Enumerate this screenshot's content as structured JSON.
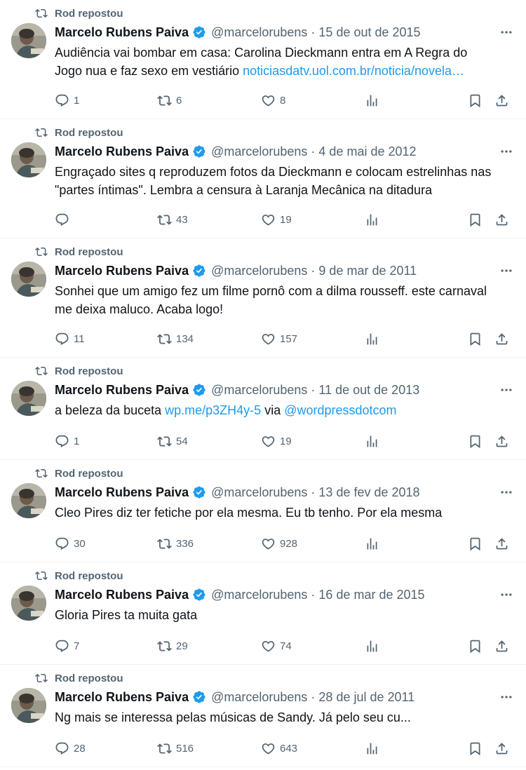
{
  "tweets": [
    {
      "repost_label": "Rod repostou",
      "name": "Marcelo Rubens Paiva",
      "handle": "@marcelorubens",
      "separator": "·",
      "date": "15 de out de 2015",
      "text": "Audiência vai bombar em casa: Carolina Dieckmann entra em A Regra do Jogo nua e faz sexo em vestiário ",
      "link": "noticiasdatv.uol.com.br/noticia/novela…",
      "text_after": "",
      "link2": "",
      "replies": "1",
      "retweets": "6",
      "likes": "8"
    },
    {
      "repost_label": "Rod repostou",
      "name": "Marcelo Rubens Paiva",
      "handle": "@marcelorubens",
      "separator": "·",
      "date": "4 de mai de 2012",
      "text": "Engraçado sites q reproduzem fotos da Dieckmann e colocam estrelinhas nas \"partes íntimas\". Lembra a censura à Laranja Mecânica na ditadura",
      "link": "",
      "text_after": "",
      "link2": "",
      "replies": "",
      "retweets": "43",
      "likes": "19"
    },
    {
      "repost_label": "Rod repostou",
      "name": "Marcelo Rubens Paiva",
      "handle": "@marcelorubens",
      "separator": "·",
      "date": "9 de mar de 2011",
      "text": "Sonhei que um amigo fez um filme pornô com a dilma rousseff. este carnaval me deixa maluco. Acaba logo!",
      "link": "",
      "text_after": "",
      "link2": "",
      "replies": "11",
      "retweets": "134",
      "likes": "157"
    },
    {
      "repost_label": "Rod repostou",
      "name": "Marcelo Rubens Paiva",
      "handle": "@marcelorubens",
      "separator": "·",
      "date": "11 de out de 2013",
      "text": "a beleza da buceta ",
      "link": "wp.me/p3ZH4y-5",
      "text_after": " via ",
      "link2": "@wordpressdotcom",
      "replies": "1",
      "retweets": "54",
      "likes": "19"
    },
    {
      "repost_label": "Rod repostou",
      "name": "Marcelo Rubens Paiva",
      "handle": "@marcelorubens",
      "separator": "·",
      "date": "13 de fev de 2018",
      "text": "Cleo Pires diz ter fetiche por ela mesma. Eu tb tenho. Por ela mesma",
      "link": "",
      "text_after": "",
      "link2": "",
      "replies": "30",
      "retweets": "336",
      "likes": "928"
    },
    {
      "repost_label": "Rod repostou",
      "name": "Marcelo Rubens Paiva",
      "handle": "@marcelorubens",
      "separator": "·",
      "date": "16 de mar de 2015",
      "text": "Gloria Pires ta muita gata",
      "link": "",
      "text_after": "",
      "link2": "",
      "replies": "7",
      "retweets": "29",
      "likes": "74"
    },
    {
      "repost_label": "Rod repostou",
      "name": "Marcelo Rubens Paiva",
      "handle": "@marcelorubens",
      "separator": "·",
      "date": "28 de jul de 2011",
      "text": "Ng mais se interessa pelas músicas de Sandy. Já pelo seu cu...",
      "link": "",
      "text_after": "",
      "link2": "",
      "replies": "28",
      "retweets": "516",
      "likes": "643"
    }
  ],
  "icons": {
    "repost": "repost-icon",
    "verified": "verified-badge-icon",
    "more": "more-icon",
    "reply": "reply-icon",
    "retweet": "retweet-icon",
    "like": "heart-icon",
    "views": "views-icon",
    "bookmark": "bookmark-icon",
    "share": "share-icon"
  },
  "colors": {
    "text": "#0f1419",
    "muted": "#536471",
    "link": "#1d9bf0",
    "verified": "#1d9bf0",
    "divider": "#eff3f4"
  }
}
